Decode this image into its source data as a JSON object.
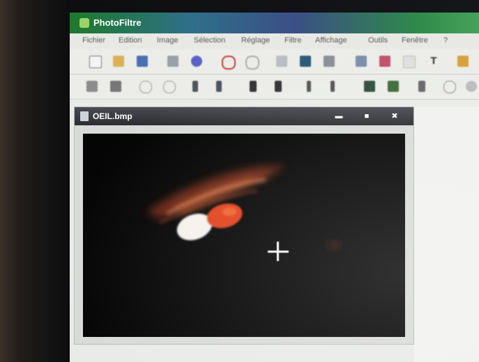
{
  "window": {
    "title": "PhotoFiltre"
  },
  "menu": {
    "items": [
      "Fichier",
      "Edition",
      "Image",
      "Sélection",
      "Réglage",
      "Filtre",
      "Affichage",
      "Outils",
      "Fenêtre",
      "?"
    ]
  },
  "toolbar": {
    "row1_icons": [
      "new-file-icon",
      "open-folder-icon",
      "save-icon",
      "print-icon",
      "scan-icon",
      "undo-icon",
      "redo-icon",
      "copy-icon",
      "paste-image-icon",
      "clipboard-icon",
      "duplicate-icon",
      "image-size-icon",
      "canvas-icon",
      "text-icon",
      "palette-icon"
    ],
    "row2_icons": [
      "transform-icon",
      "resize-icon",
      "zoom-in-icon",
      "zoom-out-icon",
      "rotate-left-icon",
      "rotate-right-icon",
      "flip-h-icon",
      "flip-v-icon",
      "crop-left-icon",
      "crop-right-icon",
      "filter-grid-icon",
      "filter-green-icon",
      "contrast-icon",
      "drop-icon",
      "brightness-icon"
    ]
  },
  "document": {
    "title": "OEIL.bmp",
    "buttons": {
      "minimize": "▬",
      "maximize": "■",
      "close": "✖"
    }
  },
  "colors": {
    "title_gradient_start": "#1d7a2a",
    "title_gradient_end": "#46a35a",
    "document_title_bar": "#2c2d31",
    "canvas_background": "#050505",
    "eye_iris": "#e2421a"
  }
}
